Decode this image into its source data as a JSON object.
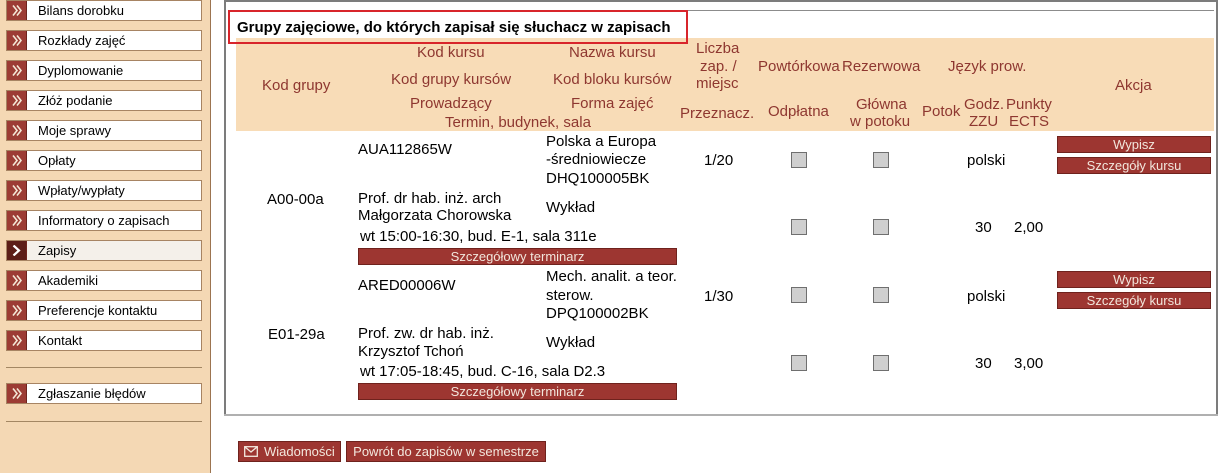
{
  "sidebar": {
    "items": [
      {
        "label": "Bilans dorobku"
      },
      {
        "label": "Rozkłady zajęć"
      },
      {
        "label": "Dyplomowanie"
      },
      {
        "label": "Złóż podanie"
      },
      {
        "label": "Moje sprawy"
      },
      {
        "label": "Opłaty"
      },
      {
        "label": "Wpłaty/wypłaty"
      },
      {
        "label": "Informatory o zapisach"
      },
      {
        "label": "Zapisy",
        "active": true
      },
      {
        "label": "Akademiki"
      },
      {
        "label": "Preferencje kontaktu"
      },
      {
        "label": "Kontakt"
      }
    ],
    "report_item": {
      "label": "Zgłaszanie błędów"
    }
  },
  "main": {
    "section_title": "Grupy zajęciowe, do których zapisał się słuchacz w zapisach",
    "headers": {
      "kod_grupy": "Kod grupy",
      "kod_kursu": "Kod kursu",
      "nazwa_kursu": "Nazwa kursu",
      "kod_grupy_kursow": "Kod grupy kursów",
      "kod_bloku_kursow": "Kod bloku kursów",
      "prowadzacy": "Prowadzący",
      "forma_zajec": "Forma zajęć",
      "termin": "Termin, budynek, sala",
      "liczba_1": "Liczba",
      "liczba_2": "zap. /",
      "liczba_3": "miejsc",
      "przeznacz": "Przeznacz.",
      "powtorkowa": "Powtórkowa",
      "odplatna": "Odpłatna",
      "rezerwowa": "Rezerwowa",
      "glowna_1": "Główna",
      "glowna_2": "w potoku",
      "jezyk": "Język prow.",
      "potok": "Potok",
      "godz_1": "Godz.",
      "godz_2": "ZZU",
      "punkty_1": "Punkty",
      "punkty_2": "ECTS",
      "akcja": "Akcja"
    },
    "rows": [
      {
        "kod_grupy": "A00-00a",
        "kod_kursu": "AUA112865W",
        "nazwa_1": "Polska a Europa",
        "nazwa_2": "-średniowiecze",
        "kod_bloku": "DHQ100005BK",
        "liczba": "1/20",
        "prow_1": "Prof. dr hab. inż. arch",
        "prow_2": "Małgorzata Chorowska",
        "forma": "Wykład",
        "termin": "wt 15:00-16:30, bud. E-1, sala 311e",
        "jezyk": "polski",
        "godz": "30",
        "ects": "2,00",
        "btn_terminarz": "Szczegółowy terminarz",
        "btn_wypisz": "Wypisz",
        "btn_szczegoly": "Szczegóły kursu"
      },
      {
        "kod_grupy": "E01-29a",
        "kod_kursu": "ARED00006W",
        "nazwa_1": "Mech. analit. a teor.",
        "nazwa_2": "sterow.",
        "kod_bloku": "DPQ100002BK",
        "liczba": "1/30",
        "prow_1": "Prof. zw. dr hab. inż.",
        "prow_2": "Krzysztof Tchoń",
        "forma": "Wykład",
        "termin": "wt 17:05-18:45, bud. C-16, sala D2.3",
        "jezyk": "polski",
        "godz": "30",
        "ects": "3,00",
        "btn_terminarz": "Szczegółowy terminarz",
        "btn_wypisz": "Wypisz",
        "btn_szczegoly": "Szczegóły kursu"
      }
    ]
  },
  "footer": {
    "messages_label": "Wiadomości",
    "back_label": "Powrót do zapisów w semestrze"
  },
  "icons": {
    "chevron": "chevron-right-icon",
    "envelope": "envelope-icon"
  },
  "colors": {
    "accent_red": "#9d3631",
    "header_band": "#f8dcb7",
    "header_text": "#8e3730",
    "sidebar_bg": "#f4d8b4",
    "title_border": "#d8252b"
  }
}
